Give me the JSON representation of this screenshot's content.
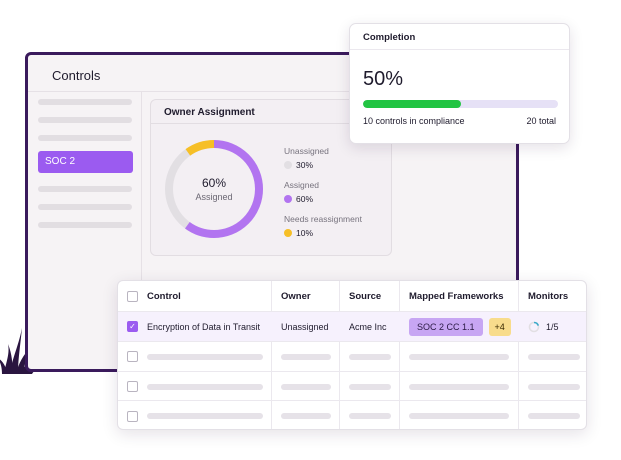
{
  "window": {
    "title": "Controls",
    "sidebar": {
      "active_item": "SOC 2"
    }
  },
  "owner_assignment": {
    "title": "Owner Assignment",
    "center_value": "60%",
    "center_label": "Assigned",
    "legend": [
      {
        "name": "Unassigned",
        "value": "30%",
        "color": "#e2dfe3"
      },
      {
        "name": "Assigned",
        "value": "60%",
        "color": "#b274f0"
      },
      {
        "name": "Needs reassignment",
        "value": "10%",
        "color": "#f6bf26"
      }
    ],
    "segments": {
      "assigned": 0.6,
      "needs_reassignment": 0.1,
      "unassigned": 0.3
    }
  },
  "completion": {
    "title": "Completion",
    "percent_text": "50%",
    "progress": 0.5,
    "left_text": "10 controls in compliance",
    "right_text": "20 total",
    "bar_color": "#22c443"
  },
  "table": {
    "columns": [
      "Control",
      "Owner",
      "Source",
      "Mapped Frameworks",
      "Monitors"
    ],
    "rows": [
      {
        "checked": true,
        "control": "Encryption of Data in Transit",
        "owner": "Unassigned",
        "source": "Acme Inc",
        "framework": "SOC 2 CC 1.1",
        "framework_more": "+4",
        "monitors": "1/5"
      }
    ]
  },
  "colors": {
    "accent": "#9b5bf0",
    "window_border": "#3a1a5c"
  }
}
